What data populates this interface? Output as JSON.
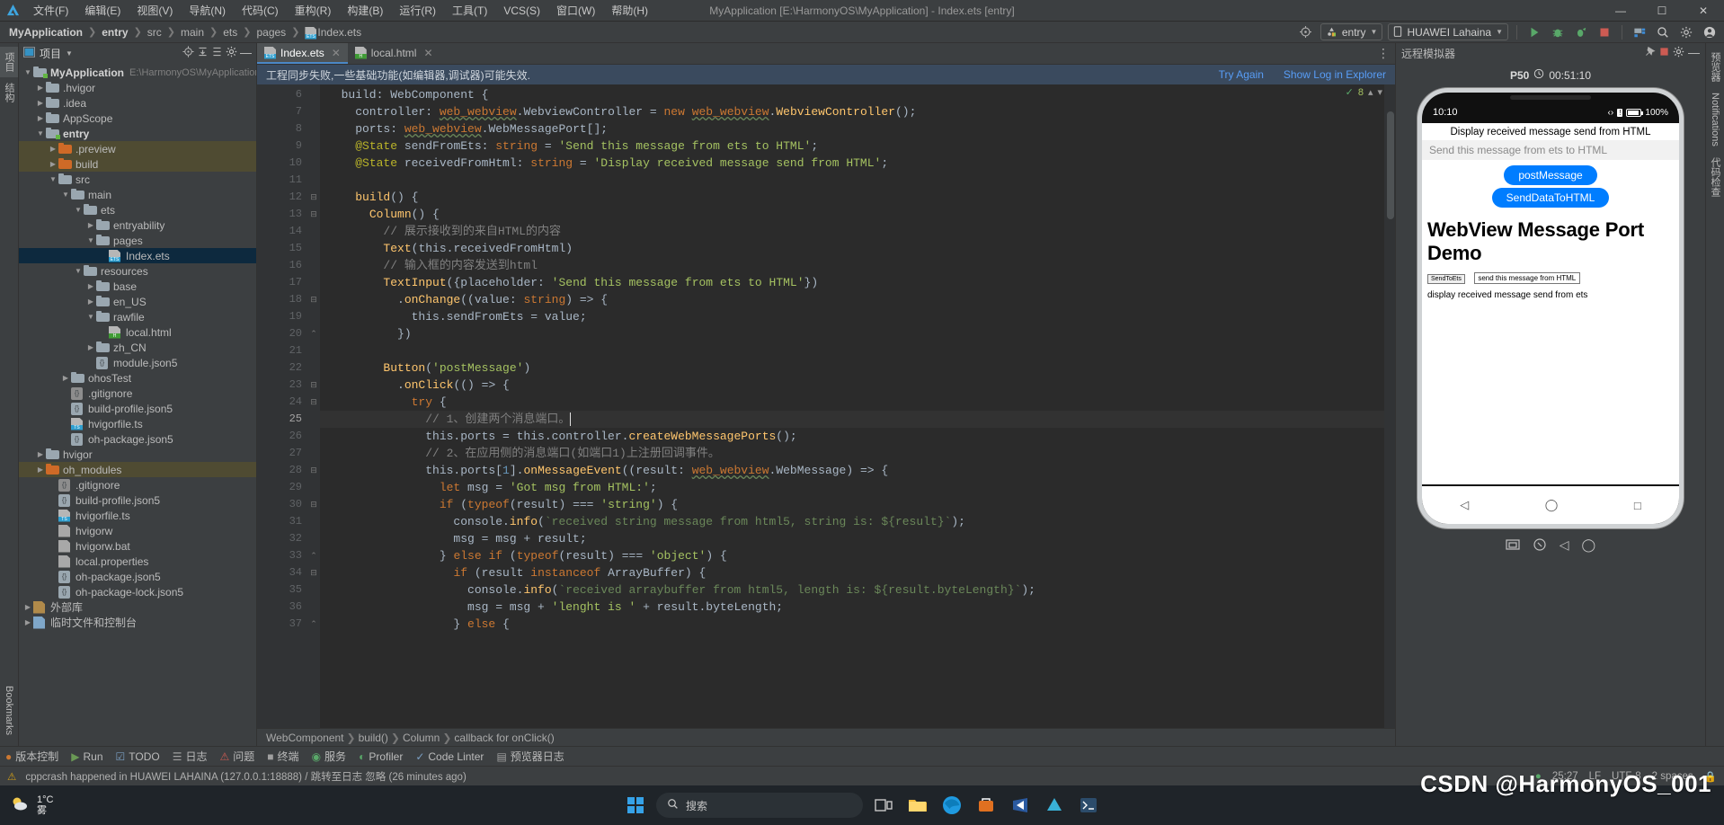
{
  "window": {
    "title": "MyApplication [E:\\HarmonyOS\\MyApplication] - Index.ets [entry]",
    "minimize": "—",
    "maximize": "☐",
    "close": "✕"
  },
  "menu": [
    "文件(F)",
    "编辑(E)",
    "视图(V)",
    "导航(N)",
    "代码(C)",
    "重构(R)",
    "构建(B)",
    "运行(R)",
    "工具(T)",
    "VCS(S)",
    "窗口(W)",
    "帮助(H)"
  ],
  "breadcrumb": {
    "items": [
      "MyApplication",
      "entry",
      "src",
      "main",
      "ets",
      "pages",
      "Index.ets"
    ]
  },
  "toolbar": {
    "run_config": "entry",
    "device": "HUAWEI Lahaina",
    "icons": [
      "target-icon",
      "run-icon",
      "debug-icon",
      "profile-icon",
      "stop-icon",
      "device-manager-icon",
      "search-icon",
      "settings-icon",
      "account-icon"
    ]
  },
  "left_rail": {
    "tabs": [
      "项目",
      "结构"
    ],
    "bottom": [
      "Bookmarks"
    ]
  },
  "right_rail": {
    "tabs": [
      "Notifications",
      "预览器",
      "代码检查"
    ]
  },
  "project_panel": {
    "title": "项目",
    "header_icons": [
      "locate-icon",
      "collapse-all-icon",
      "expand-all-icon",
      "gear-icon",
      "hide-icon"
    ],
    "tree": [
      {
        "label": "MyApplication",
        "sub": "E:\\HarmonyOS\\MyApplication",
        "depth": 0,
        "arrow": "v",
        "icon": "module-folder-icon",
        "bold": true
      },
      {
        "label": ".hvigor",
        "depth": 1,
        "arrow": ">",
        "icon": "folder-icon"
      },
      {
        "label": ".idea",
        "depth": 1,
        "arrow": ">",
        "icon": "folder-icon"
      },
      {
        "label": "AppScope",
        "depth": 1,
        "arrow": ">",
        "icon": "folder-icon"
      },
      {
        "label": "entry",
        "depth": 1,
        "arrow": "v",
        "icon": "module-folder-icon",
        "bold": true
      },
      {
        "label": ".preview",
        "depth": 2,
        "arrow": ">",
        "icon": "folder-orange-icon",
        "state": "hl"
      },
      {
        "label": "build",
        "depth": 2,
        "arrow": ">",
        "icon": "folder-orange-icon",
        "state": "hl"
      },
      {
        "label": "src",
        "depth": 2,
        "arrow": "v",
        "icon": "folder-icon"
      },
      {
        "label": "main",
        "depth": 3,
        "arrow": "v",
        "icon": "folder-icon"
      },
      {
        "label": "ets",
        "depth": 4,
        "arrow": "v",
        "icon": "folder-icon"
      },
      {
        "label": "entryability",
        "depth": 5,
        "arrow": ">",
        "icon": "folder-icon"
      },
      {
        "label": "pages",
        "depth": 5,
        "arrow": "v",
        "icon": "folder-icon"
      },
      {
        "label": "Index.ets",
        "depth": 6,
        "arrow": "",
        "icon": "ets-file-icon",
        "state": "sel"
      },
      {
        "label": "resources",
        "depth": 4,
        "arrow": "v",
        "icon": "folder-icon"
      },
      {
        "label": "base",
        "depth": 5,
        "arrow": ">",
        "icon": "folder-icon"
      },
      {
        "label": "en_US",
        "depth": 5,
        "arrow": ">",
        "icon": "folder-icon"
      },
      {
        "label": "rawfile",
        "depth": 5,
        "arrow": "v",
        "icon": "folder-icon"
      },
      {
        "label": "local.html",
        "depth": 6,
        "arrow": "",
        "icon": "html-file-icon"
      },
      {
        "label": "zh_CN",
        "depth": 5,
        "arrow": ">",
        "icon": "folder-icon"
      },
      {
        "label": "module.json5",
        "depth": 5,
        "arrow": "",
        "icon": "json-file-icon"
      },
      {
        "label": "ohosTest",
        "depth": 3,
        "arrow": ">",
        "icon": "folder-icon"
      },
      {
        "label": ".gitignore",
        "depth": 3,
        "arrow": "",
        "icon": "gitignore-file-icon"
      },
      {
        "label": "build-profile.json5",
        "depth": 3,
        "arrow": "",
        "icon": "json-file-icon"
      },
      {
        "label": "hvigorfile.ts",
        "depth": 3,
        "arrow": "",
        "icon": "ts-file-icon"
      },
      {
        "label": "oh-package.json5",
        "depth": 3,
        "arrow": "",
        "icon": "json-file-icon"
      },
      {
        "label": "hvigor",
        "depth": 1,
        "arrow": ">",
        "icon": "folder-icon"
      },
      {
        "label": "oh_modules",
        "depth": 1,
        "arrow": ">",
        "icon": "folder-orange-icon",
        "state": "hl"
      },
      {
        "label": ".gitignore",
        "depth": 2,
        "arrow": "",
        "icon": "gitignore-file-icon"
      },
      {
        "label": "build-profile.json5",
        "depth": 2,
        "arrow": "",
        "icon": "json-file-icon"
      },
      {
        "label": "hvigorfile.ts",
        "depth": 2,
        "arrow": "",
        "icon": "ts-file-icon"
      },
      {
        "label": "hvigorw",
        "depth": 2,
        "arrow": "",
        "icon": "script-file-icon"
      },
      {
        "label": "hvigorw.bat",
        "depth": 2,
        "arrow": "",
        "icon": "bat-file-icon"
      },
      {
        "label": "local.properties",
        "depth": 2,
        "arrow": "",
        "icon": "properties-file-icon"
      },
      {
        "label": "oh-package.json5",
        "depth": 2,
        "arrow": "",
        "icon": "json-file-icon"
      },
      {
        "label": "oh-package-lock.json5",
        "depth": 2,
        "arrow": "",
        "icon": "json-file-icon"
      },
      {
        "label": "外部库",
        "depth": 0,
        "arrow": ">",
        "icon": "library-icon"
      },
      {
        "label": "临时文件和控制台",
        "depth": 0,
        "arrow": ">",
        "icon": "scratch-icon"
      }
    ]
  },
  "editor": {
    "tabs": [
      {
        "label": "Index.ets",
        "icon": "ets-file-icon",
        "active": true
      },
      {
        "label": "local.html",
        "icon": "html-file-icon",
        "active": false
      }
    ],
    "notification": {
      "message": "工程同步失败,一些基础功能(如编辑器,调试器)可能失效.",
      "try_again": "Try Again",
      "show_log": "Show Log in Explorer"
    },
    "inspection": {
      "count": "8"
    },
    "first_line_number": 6,
    "lines": [
      {
        "n": 6,
        "fold": "",
        "text": "  build: WebComponent {"
      },
      {
        "n": 7,
        "fold": "",
        "text": "    controller: web_webview.WebviewController = new web_webview.WebviewController();"
      },
      {
        "n": 8,
        "fold": "",
        "text": "    ports: web_webview.WebMessagePort[];"
      },
      {
        "n": 9,
        "fold": "",
        "text": "    @State sendFromEts: string = 'Send this message from ets to HTML';"
      },
      {
        "n": 10,
        "fold": "",
        "text": "    @State receivedFromHtml: string = 'Display received message send from HTML';"
      },
      {
        "n": 11,
        "fold": "",
        "text": ""
      },
      {
        "n": 12,
        "fold": "-",
        "text": "    build() {"
      },
      {
        "n": 13,
        "fold": "-",
        "text": "      Column() {"
      },
      {
        "n": 14,
        "fold": "",
        "text": "        // 展示接收到的来自HTML的内容"
      },
      {
        "n": 15,
        "fold": "",
        "text": "        Text(this.receivedFromHtml)"
      },
      {
        "n": 16,
        "fold": "",
        "text": "        // 输入框的内容发送到html"
      },
      {
        "n": 17,
        "fold": "",
        "text": "        TextInput({placeholder: 'Send this message from ets to HTML'})"
      },
      {
        "n": 18,
        "fold": "-",
        "text": "          .onChange((value: string) => {"
      },
      {
        "n": 19,
        "fold": "",
        "text": "            this.sendFromEts = value;"
      },
      {
        "n": 20,
        "fold": "^",
        "text": "          })"
      },
      {
        "n": 21,
        "fold": "",
        "text": ""
      },
      {
        "n": 22,
        "fold": "",
        "text": "        Button('postMessage')"
      },
      {
        "n": 23,
        "fold": "-",
        "text": "          .onClick(() => {"
      },
      {
        "n": 24,
        "fold": "-",
        "text": "            try {"
      },
      {
        "n": 25,
        "fold": "",
        "text": "              // 1、创建两个消息端口。",
        "current": true
      },
      {
        "n": 26,
        "fold": "",
        "text": "              this.ports = this.controller.createWebMessagePorts();"
      },
      {
        "n": 27,
        "fold": "",
        "text": "              // 2、在应用侧的消息端口(如端口1)上注册回调事件。"
      },
      {
        "n": 28,
        "fold": "-",
        "text": "              this.ports[1].onMessageEvent((result: web_webview.WebMessage) => {"
      },
      {
        "n": 29,
        "fold": "",
        "text": "                let msg = 'Got msg from HTML:';"
      },
      {
        "n": 30,
        "fold": "-",
        "text": "                if (typeof(result) === 'string') {"
      },
      {
        "n": 31,
        "fold": "",
        "text": "                  console.info(`received string message from html5, string is: ${result}`);"
      },
      {
        "n": 32,
        "fold": "",
        "text": "                  msg = msg + result;"
      },
      {
        "n": 33,
        "fold": "^",
        "text": "                } else if (typeof(result) === 'object') {"
      },
      {
        "n": 34,
        "fold": "-",
        "text": "                  if (result instanceof ArrayBuffer) {"
      },
      {
        "n": 35,
        "fold": "",
        "text": "                    console.info(`received arraybuffer from html5, length is: ${result.byteLength}`);"
      },
      {
        "n": 36,
        "fold": "",
        "text": "                    msg = msg + 'lenght is ' + result.byteLength;"
      },
      {
        "n": 37,
        "fold": "^",
        "text": "                  } else {"
      }
    ],
    "status_breadcrumb": [
      "WebComponent",
      "build()",
      "Column",
      "callback for onClick()"
    ]
  },
  "emulator": {
    "title": "远程模拟器",
    "device_label": "P50",
    "timer": "00:51:10",
    "header_icons": [
      "pin-icon",
      "stop-icon",
      "gear-icon",
      "minimize-icon"
    ],
    "phone": {
      "status_time": "10:10",
      "battery": "100%",
      "received_text": "Display received message send from HTML",
      "input_placeholder": "Send this message from ets to HTML",
      "buttons": [
        "postMessage",
        "SendDataToHTML"
      ],
      "web_title": "WebView Message Port Demo",
      "web_button": "SendToEts",
      "web_input_value": "send this message from HTML",
      "web_text": "display received message send from ets",
      "nav": [
        "back-icon",
        "home-icon",
        "recents-icon"
      ]
    },
    "tools": [
      "screenshot-icon",
      "rotate-icon",
      "back-icon",
      "home-icon"
    ]
  },
  "bottom_toolwindows": [
    {
      "label": "版本控制",
      "icon": "vcs-icon"
    },
    {
      "label": "Run",
      "icon": "run-icon"
    },
    {
      "label": "TODO",
      "icon": "todo-icon"
    },
    {
      "label": "日志",
      "icon": "log-icon"
    },
    {
      "label": "问题",
      "icon": "problems-icon"
    },
    {
      "label": "终端",
      "icon": "terminal-icon"
    },
    {
      "label": "服务",
      "icon": "services-icon"
    },
    {
      "label": "Profiler",
      "icon": "profiler-icon"
    },
    {
      "label": "Code Linter",
      "icon": "linter-icon"
    },
    {
      "label": "预览器日志",
      "icon": "previewer-log-icon"
    }
  ],
  "status_bar": {
    "message": "cppcrash happened in HUAWEI LAHAINA (127.0.0.1:18888) / 跳转至日志   忽略 (26 minutes ago)",
    "caret": "25:27",
    "line_sep": "LF",
    "encoding": "UTF-8",
    "indent": "2 spaces",
    "lock": "lock-icon"
  },
  "taskbar": {
    "weather_temp": "1°C",
    "weather_desc": "雾",
    "search_placeholder": "搜索",
    "icons": [
      "start-icon",
      "search-icon",
      "taskview-icon",
      "explorer-icon",
      "edge-icon",
      "store-icon",
      "vscode-icon",
      "devtools-icon",
      "terminal-icon"
    ],
    "watermark": "CSDN @HarmonyOS_001"
  }
}
